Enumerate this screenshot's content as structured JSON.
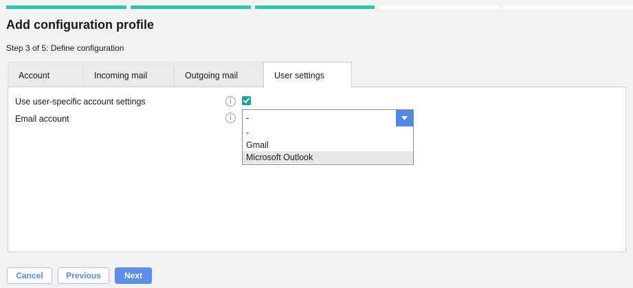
{
  "wizard": {
    "title": "Add configuration profile",
    "step_text": "Step 3 of 5: Define configuration",
    "steps_total": 5,
    "steps_completed": 3
  },
  "tabs": [
    {
      "label": "Account"
    },
    {
      "label": "Incoming mail"
    },
    {
      "label": "Outgoing mail"
    },
    {
      "label": "User settings",
      "active": true
    }
  ],
  "form": {
    "use_user_specific": {
      "label": "Use user-specific account settings",
      "checked": true
    },
    "email_account": {
      "label": "Email account",
      "value": "-",
      "options": [
        "-",
        "Gmail",
        "Microsoft Outlook"
      ],
      "highlighted_option": "Microsoft Outlook"
    }
  },
  "buttons": {
    "cancel": "Cancel",
    "previous": "Previous",
    "next": "Next"
  },
  "colors": {
    "progress_done": "#26c9a8",
    "accent": "#4f8ae6",
    "checkbox": "#1aa39a"
  }
}
